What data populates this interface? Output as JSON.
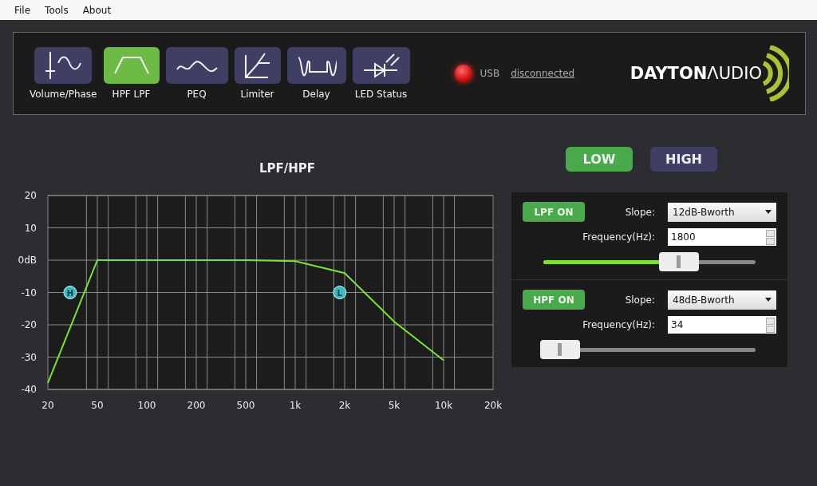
{
  "menu": [
    {
      "label": "File"
    },
    {
      "label": "Tools"
    },
    {
      "label": "About"
    }
  ],
  "tabs": [
    {
      "label": "Volume/Phase",
      "selected": false
    },
    {
      "label": "HPF LPF",
      "selected": true
    },
    {
      "label": "PEQ",
      "selected": false
    },
    {
      "label": "Limiter",
      "selected": false
    },
    {
      "label": "Delay",
      "selected": false
    },
    {
      "label": "LED Status",
      "selected": false
    }
  ],
  "usb": {
    "label": "USB",
    "status": "disconnected",
    "connected": false
  },
  "logo": {
    "brand": "DAYTON",
    "suffix": "ΛUDIO"
  },
  "graph": {
    "chart_data": {
      "type": "line",
      "title": "LPF/HPF",
      "categories": [
        "20",
        "50",
        "100",
        "200",
        "500",
        "1k",
        "2k",
        "5k",
        "10k",
        "20k"
      ],
      "series": [
        {
          "color": "#7ee03a",
          "values": [
            -38,
            0,
            0,
            0,
            0,
            -0.3,
            -4,
            -19,
            -31,
            null
          ]
        }
      ],
      "ylim": [
        -40,
        20
      ],
      "grid": true,
      "yticks": [
        {
          "value": 20,
          "label": "20"
        },
        {
          "value": 10,
          "label": "10"
        },
        {
          "value": 0,
          "label": "0dB"
        },
        {
          "value": -10,
          "label": "-10"
        },
        {
          "value": -20,
          "label": "-20"
        },
        {
          "value": -30,
          "label": "-30"
        },
        {
          "value": -40,
          "label": "-40"
        }
      ],
      "annotations": [
        "H",
        "L"
      ]
    }
  },
  "bands": [
    {
      "label": "LOW",
      "selected": true
    },
    {
      "label": "HIGH",
      "selected": false
    }
  ],
  "filters": [
    {
      "toggle": "LPF ON",
      "on": true,
      "slope_label": "Slope:",
      "slope": "12dB-Bworth",
      "freq_label": "Frequency(Hz):",
      "freq": "1800",
      "level": 0.64
    },
    {
      "toggle": "HPF ON",
      "on": true,
      "slope_label": "Slope:",
      "slope": "48dB-Bworth",
      "freq_label": "Frequency(Hz):",
      "freq": "34",
      "level": 0.08
    }
  ]
}
